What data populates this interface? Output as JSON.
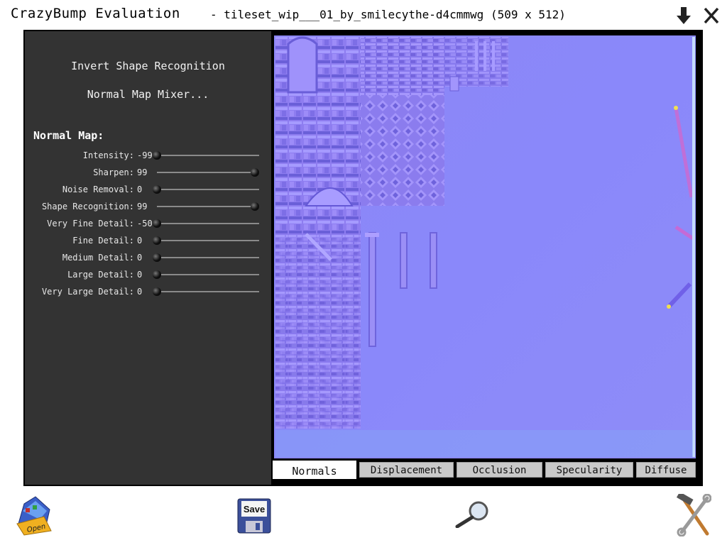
{
  "window": {
    "app_title": "CrazyBump Evaluation",
    "file_title": "- tileset_wip___01_by_smilecythe-d4cmmwg (509 x 512)",
    "minimize_icon": "down-arrow-icon",
    "close_icon": "close-icon"
  },
  "left_panel": {
    "menu": [
      "Invert Shape Recognition",
      "Normal Map Mixer..."
    ],
    "section_title": "Normal Map:",
    "sliders": [
      {
        "label": "Intensity:",
        "value": "-99",
        "level": 0.0
      },
      {
        "label": "Sharpen:",
        "value": "99",
        "level": 0.96
      },
      {
        "label": "Noise Removal:",
        "value": "0",
        "level": 0.0
      },
      {
        "label": "Shape Recognition:",
        "value": "99",
        "level": 0.96
      },
      {
        "label": "Very Fine Detail:",
        "value": "-50",
        "level": 0.0
      },
      {
        "label": "Fine Detail:",
        "value": "0",
        "level": 0.0
      },
      {
        "label": "Medium Detail:",
        "value": "0",
        "level": 0.0
      },
      {
        "label": "Large Detail:",
        "value": "0",
        "level": 0.0
      },
      {
        "label": "Very Large Detail:",
        "value": "0",
        "level": 0.0
      }
    ]
  },
  "tabs": [
    {
      "label": "Normals",
      "active": true
    },
    {
      "label": "Displacement",
      "active": false
    },
    {
      "label": "Occlusion",
      "active": false
    },
    {
      "label": "Specularity",
      "active": false
    },
    {
      "label": "Diffuse",
      "active": false
    }
  ],
  "toolbar": {
    "open_label": "Open",
    "save_label": "Save",
    "zoom_icon": "magnifier-icon",
    "settings_icon": "tools-icon"
  },
  "colors": {
    "panel_bg": "#333333",
    "normal_map_base": "#8a86f8"
  }
}
